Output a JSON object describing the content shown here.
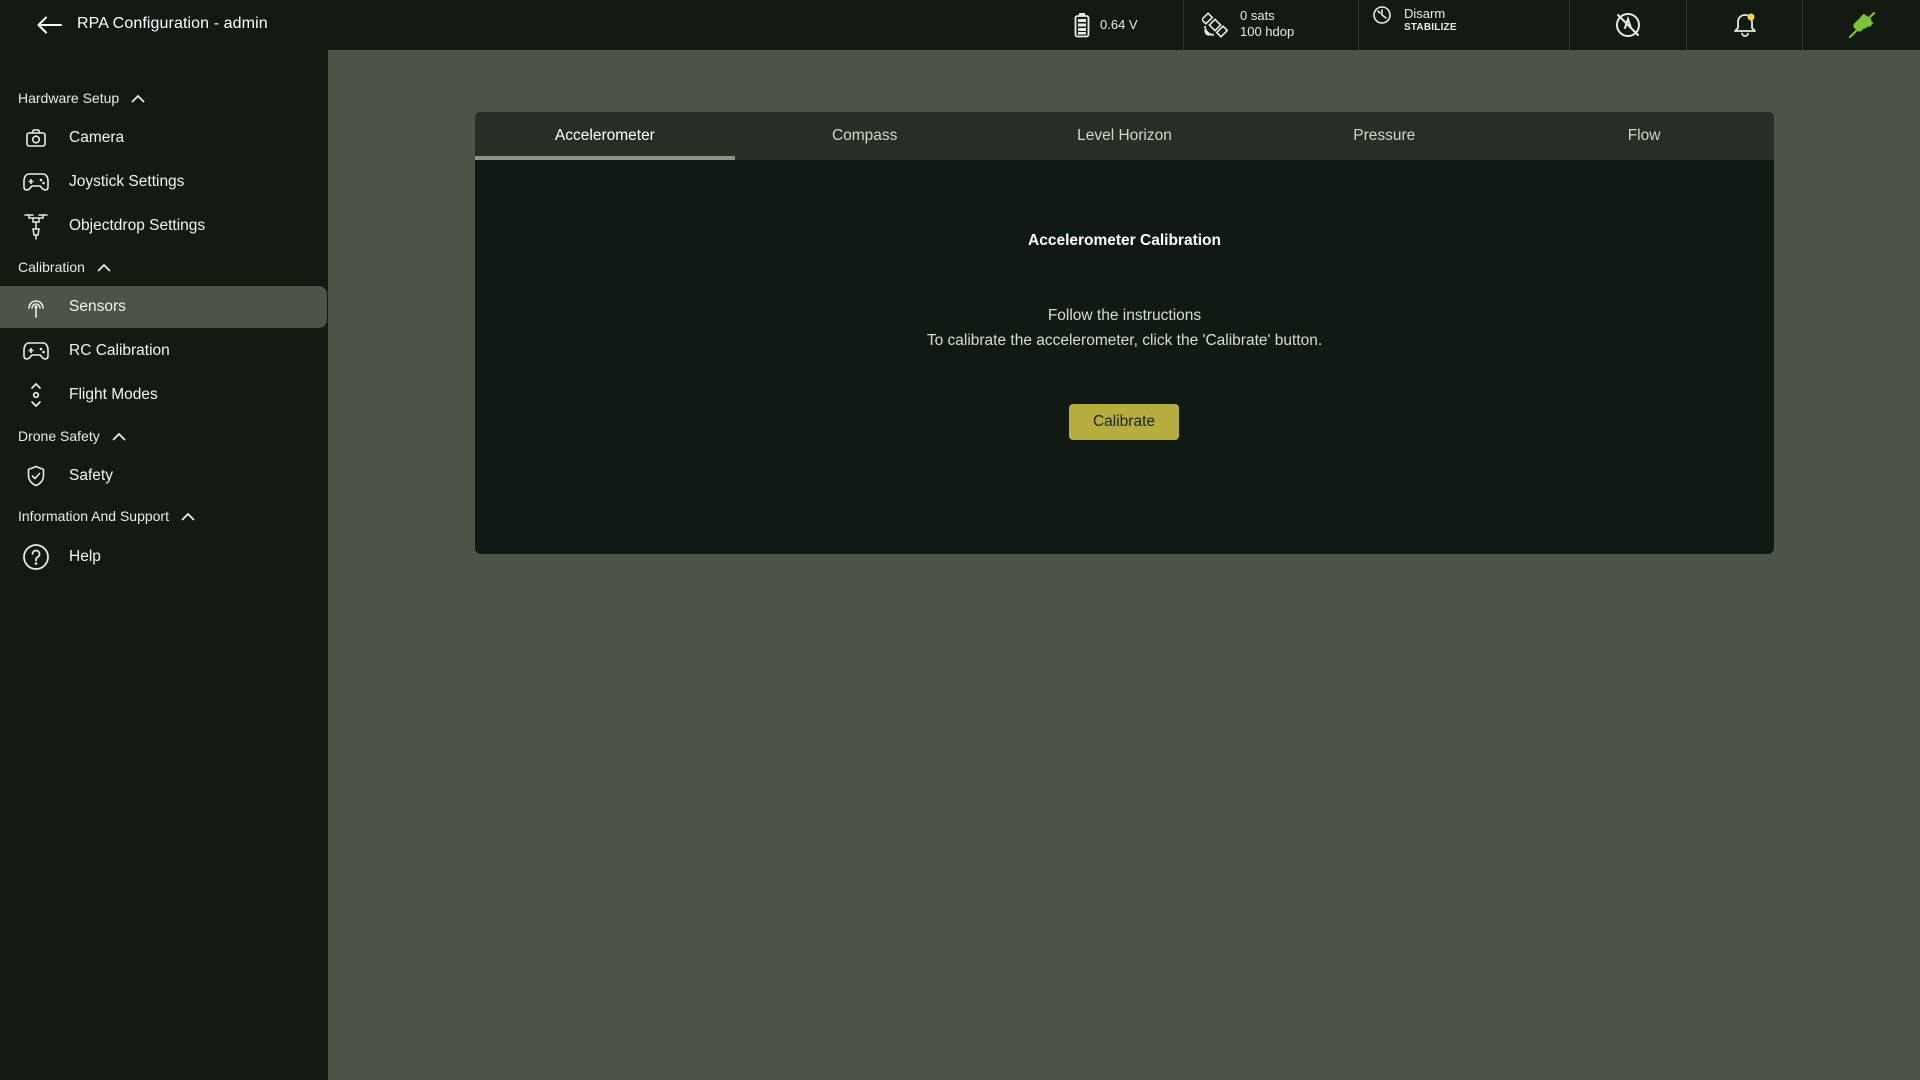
{
  "header": {
    "title": "RPA Configuration - admin",
    "back_icon": "arrow-left-icon",
    "battery": {
      "value": "0.64 V",
      "icon": "battery-icon"
    },
    "gps": {
      "sats": "0 sats",
      "hdop": "100 hdop",
      "icon": "satellite-icon"
    },
    "arm": {
      "state": "Disarm",
      "mode": "STABILIZE",
      "icon": "arming-icon"
    },
    "icons": [
      "compass-slash-icon",
      "bell-icon",
      "plug-connected-icon"
    ],
    "colors": {
      "connected": "#7dc23a",
      "notification_dot": "#f0d45a"
    }
  },
  "sidebar": {
    "sections": [
      {
        "label": "Hardware Setup",
        "items": [
          {
            "label": "Camera",
            "icon": "camera-icon"
          },
          {
            "label": "Joystick Settings",
            "icon": "gamepad-icon"
          },
          {
            "label": "Objectdrop Settings",
            "icon": "drone-drop-icon"
          }
        ]
      },
      {
        "label": "Calibration",
        "items": [
          {
            "label": "Sensors",
            "icon": "sensor-icon",
            "active": true
          },
          {
            "label": "RC Calibration",
            "icon": "gamepad-icon"
          },
          {
            "label": "Flight Modes",
            "icon": "flight-modes-icon"
          }
        ]
      },
      {
        "label": "Drone Safety",
        "items": [
          {
            "label": "Safety",
            "icon": "shield-check-icon"
          }
        ]
      },
      {
        "label": "Information And Support",
        "items": [
          {
            "label": "Help",
            "icon": "help-circle-icon"
          }
        ]
      }
    ]
  },
  "main": {
    "tabs": [
      {
        "label": "Accelerometer",
        "active": true
      },
      {
        "label": "Compass"
      },
      {
        "label": "Level Horizon"
      },
      {
        "label": "Pressure"
      },
      {
        "label": "Flow"
      }
    ],
    "title": "Accelerometer Calibration",
    "instruction_line1": "Follow the instructions",
    "instruction_line2": "To calibrate the accelerometer, click the 'Calibrate' button.",
    "button_label": "Calibrate",
    "colors": {
      "button": "#b7ad3f"
    }
  }
}
